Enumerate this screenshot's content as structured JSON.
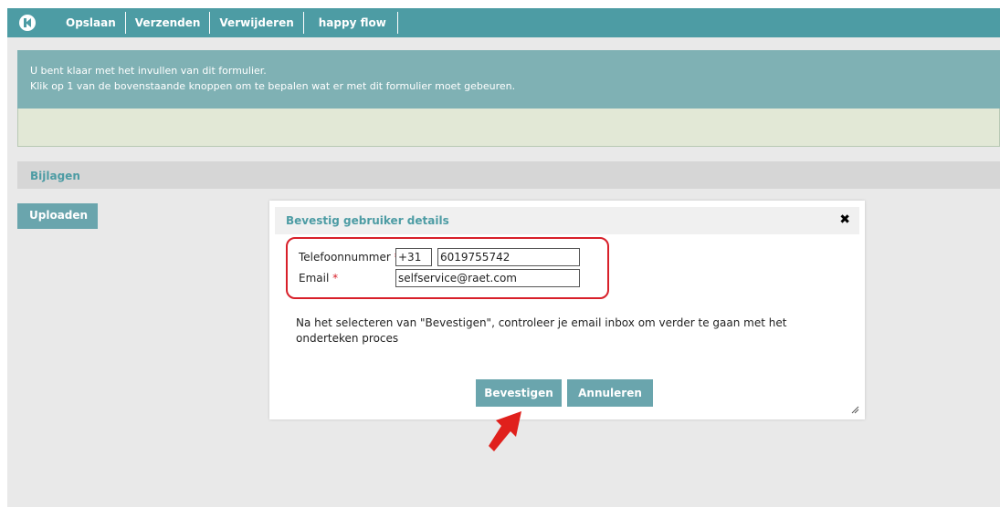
{
  "toolbar": {
    "buttons": [
      "Opslaan",
      "Verzenden",
      "Verwijderen",
      "happy flow"
    ]
  },
  "banner": {
    "line1": "U bent klaar met het invullen van dit formulier.",
    "line2": "Klik op 1 van de bovenstaande knoppen om te bepalen wat er met dit formulier moet gebeuren."
  },
  "attachments": {
    "title": "Bijlagen",
    "upload_label": "Uploaden"
  },
  "modal": {
    "title": "Bevestig gebruiker details",
    "close_glyph": "✖",
    "phone_label": "Telefoonnummer",
    "phone_prefix": "+31",
    "phone_number": "6019755742",
    "email_label": "Email",
    "email_value": "selfservice@raet.com",
    "required_marker": "*",
    "note": "Na het selecteren van \"Bevestigen\", controleer je email inbox om verder te gaan met het onderteken proces",
    "confirm_label": "Bevestigen",
    "cancel_label": "Annuleren"
  },
  "colors": {
    "accent": "#4d9ca4",
    "button": "#6aa5ad",
    "highlight": "#d8202a"
  }
}
